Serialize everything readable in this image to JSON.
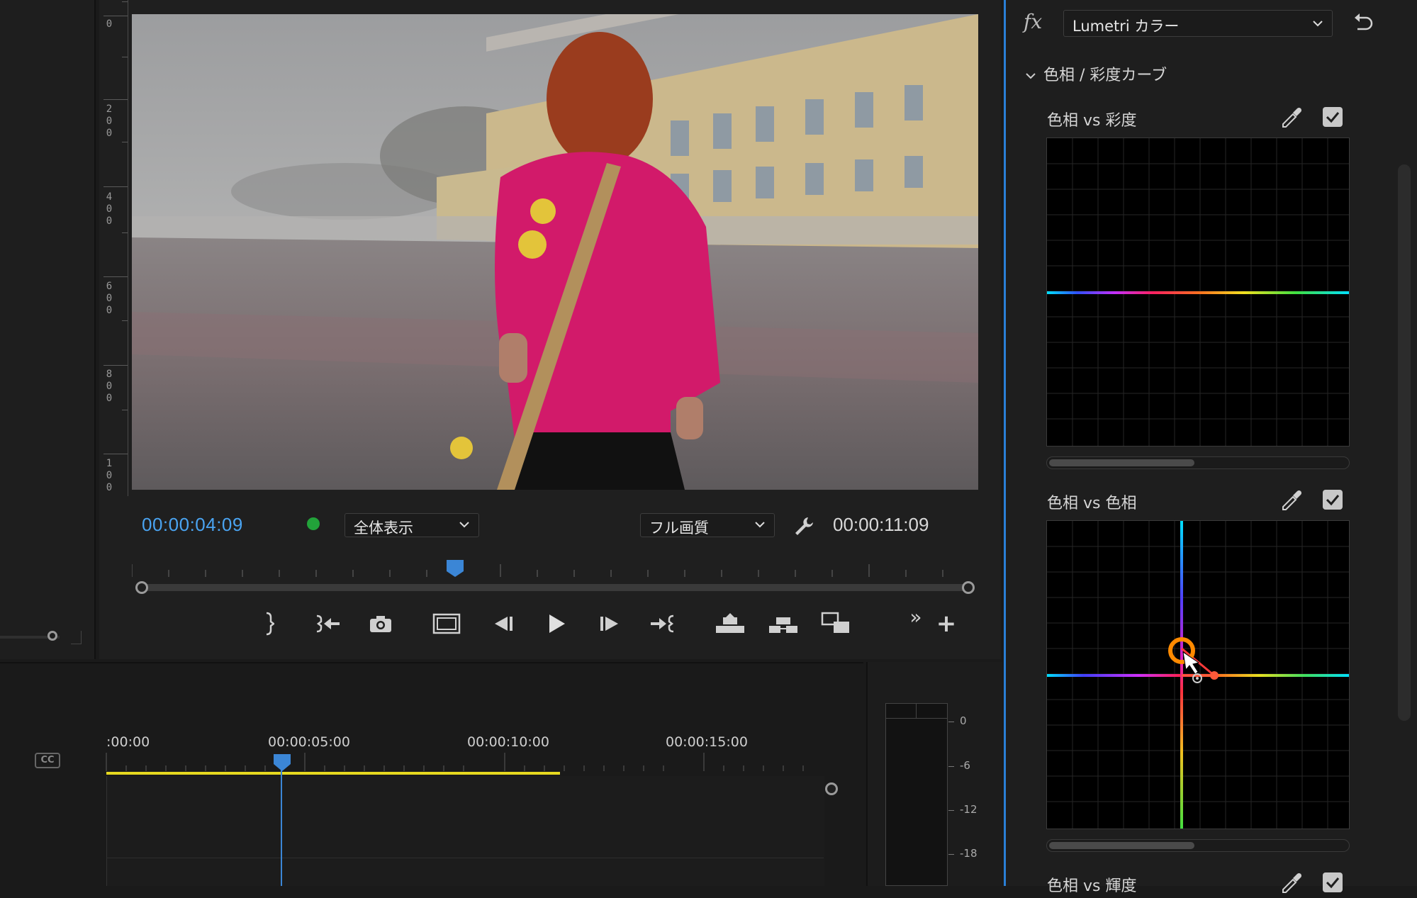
{
  "monitor": {
    "current_timecode": "00:00:04:09",
    "zoom_select": "全体表示",
    "quality_select": "フル画質",
    "duration_timecode": "00:00:11:09",
    "ruler_labels": [
      "0",
      "200",
      "400",
      "600",
      "800",
      "100"
    ]
  },
  "transport": {
    "mark_out": "mark-out",
    "go_to_in": "go-to-in",
    "export_frame": "export-frame",
    "safe_margins": "safe-margins",
    "step_back": "step-back",
    "play": "play",
    "step_forward": "step-forward",
    "go_to_out": "go-to-out",
    "lift": "lift",
    "extract": "extract",
    "comparison_view": "comparison-view",
    "more": "»",
    "add": "+"
  },
  "timeline": {
    "time_labels": [
      ":00:00",
      "00:00:05:00",
      "00:00:10:00",
      "00:00:15:00"
    ],
    "cc_label": "CC"
  },
  "audio_meter": {
    "scale": [
      "0",
      "-6",
      "-12",
      "-18"
    ]
  },
  "effect_panel": {
    "fx_label": "fx",
    "effect_name": "Lumetri カラー",
    "section_title": "色相 / 彩度カーブ",
    "curves": [
      {
        "title": "色相 vs 彩度",
        "enabled": true
      },
      {
        "title": "色相 vs 色相",
        "enabled": true
      },
      {
        "title": "色相 vs 輝度",
        "enabled": true
      }
    ]
  },
  "colors": {
    "accent": "#4aa3f0",
    "divider": "#2a7fd6",
    "work_area": "#e6d820",
    "control_point_active": "#ff8a00",
    "control_point": "#ff5a3a"
  }
}
